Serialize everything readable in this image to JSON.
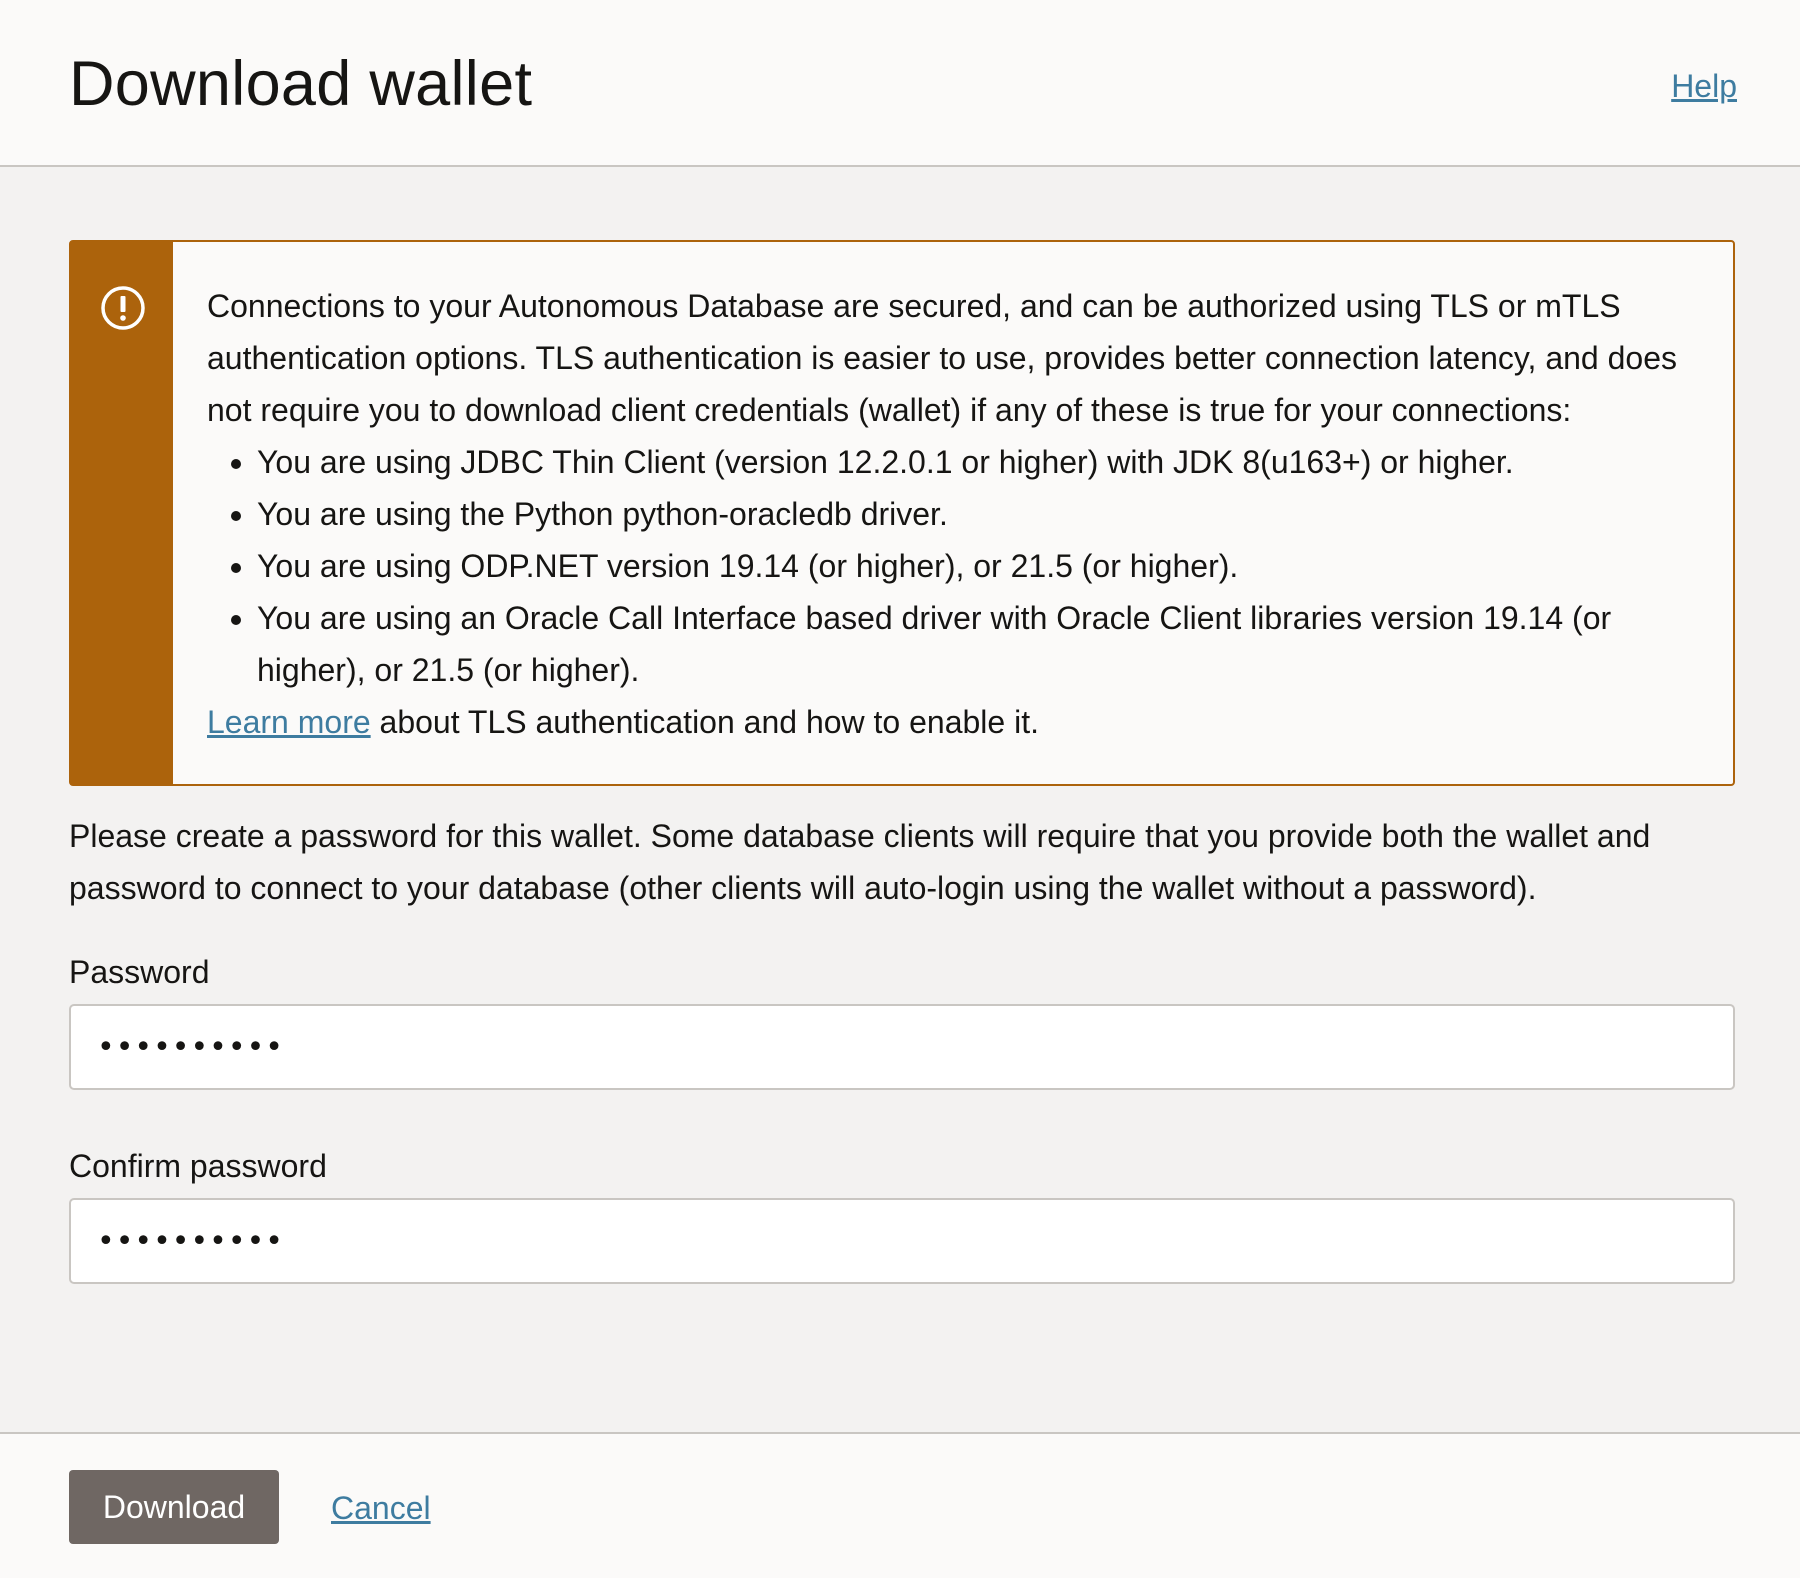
{
  "dialog": {
    "title": "Download wallet",
    "help_label": "Help"
  },
  "notice": {
    "icon": "warning-circle-icon",
    "accent_color": "#ac630c",
    "intro": "Connections to your Autonomous Database are secured, and can be authorized using TLS or mTLS authentication options. TLS authentication is easier to use, provides better connection latency, and does not require you to download client credentials (wallet) if any of these is true for your connections:",
    "bullets": [
      "You are using JDBC Thin Client (version 12.2.0.1 or higher) with JDK 8(u163+) or higher.",
      "You are using the Python python-oracledb driver.",
      "You are using ODP.NET version 19.14 (or higher), or 21.5 (or higher).",
      "You are using an Oracle Call Interface based driver with Oracle Client libraries version 19.14 (or higher), or 21.5 (or higher)."
    ],
    "learn_more_link": "Learn more",
    "learn_more_suffix": " about TLS authentication and how to enable it."
  },
  "form": {
    "instructions": "Please create a password for this wallet. Some database clients will require that you provide both the wallet and password to connect to your database (other clients will auto-login using the wallet without a password).",
    "password_label": "Password",
    "password_value": "••••••••••",
    "confirm_label": "Confirm password",
    "confirm_value": "••••••••••"
  },
  "footer": {
    "download_label": "Download",
    "cancel_label": "Cancel",
    "download_color": "#6f6763"
  },
  "colors": {
    "link": "#3e7ca0",
    "background": "#f3f2f1"
  }
}
